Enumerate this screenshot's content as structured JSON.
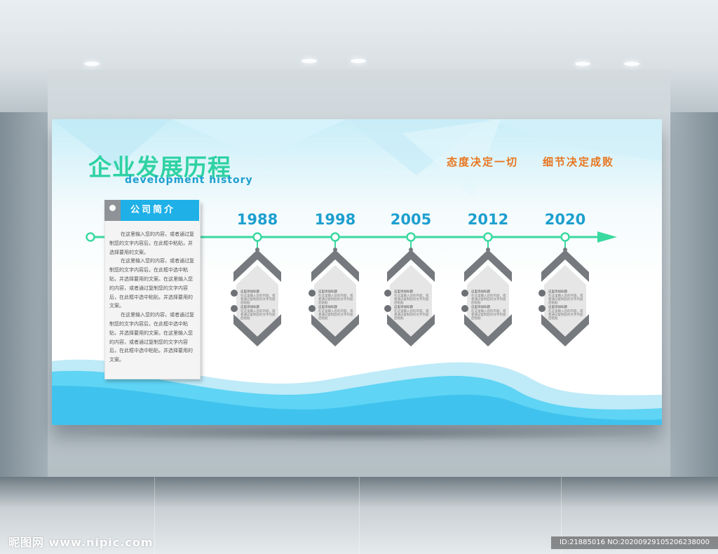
{
  "board": {
    "title_cn": "企业发展历程",
    "title_en": "development history",
    "slogans": [
      "态度决定一切",
      "细节决定成败"
    ],
    "intro": {
      "tab_label": "公司简介",
      "paragraphs": [
        "在这里输入您的内容，或者通过复制您的文字内容后，在此框中粘贴，并选择要用的文案。",
        "在这里输入您的内容，或者通过复制您的文字内容后，在此框中选中粘贴，并选择要用的文案。在这里输入您的内容，或者通过复制您的文字内容后，在此框中选中粘贴，并选择要用的文案。",
        "在这里输入您的内容，或者通过复制您的文字内容后，在此框中选中粘贴，并选择要用的文案。在这里输入您的内容，或者通过复制您的文字内容后，在此框中选中粘贴，并选择要用的文案。"
      ]
    },
    "timeline": [
      {
        "year": "1988",
        "item_title": "这里添加标题",
        "item_text": "在这里输入您的内容，或者通过复制您的文字内容后粘贴"
      },
      {
        "year": "1998",
        "item_title": "这里添加标题",
        "item_text": "在这里输入您的内容，或者通过复制您的文字内容后粘贴"
      },
      {
        "year": "2005",
        "item_title": "这里添加标题",
        "item_text": "在这里输入您的内容，或者通过复制您的文字内容后粘贴"
      },
      {
        "year": "2012",
        "item_title": "这里添加标题",
        "item_text": "在这里输入您的内容，或者通过复制您的文字内容后粘贴"
      },
      {
        "year": "2020",
        "item_title": "这里添加标题",
        "item_text": "在这里输入您的内容，或者通过复制您的文字内容后粘贴"
      }
    ]
  },
  "watermark": "昵图网 www.nipic.com",
  "image_id_text": "ID:21885016 NO:20200929105206238000",
  "colors": {
    "title_green": "#2fd2a3",
    "accent_blue": "#1d9fcf",
    "slogan_orange": "#e8761f",
    "timeline_green": "#3ad9a0",
    "hexagon_gray": "#76797d"
  }
}
